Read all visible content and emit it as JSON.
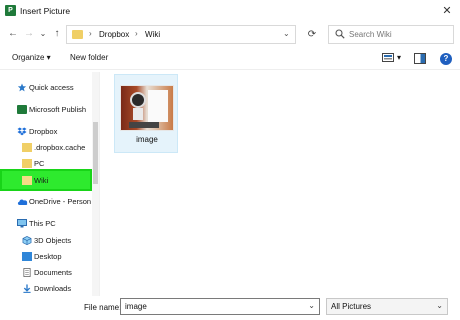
{
  "window": {
    "title": "Insert Picture",
    "close_glyph": "✕"
  },
  "address": {
    "back_glyph": "←",
    "forward_glyph": "→",
    "recent_glyph": "⌄",
    "up_glyph": "↑",
    "breadcrumb": [
      "Dropbox",
      "Wiki"
    ],
    "separator": "›",
    "dropdown_glyph": "⌄",
    "refresh_glyph": "⟳"
  },
  "search": {
    "placeholder": "Search Wiki"
  },
  "toolbar": {
    "organize_label": "Organize ▾",
    "new_folder_label": "New folder",
    "view_dropdown_glyph": "▾",
    "help_glyph": "?"
  },
  "nav": {
    "items": [
      {
        "label": "Quick access",
        "icon": "star-icon"
      },
      {
        "label": "Microsoft Publish",
        "icon": "publisher-icon"
      },
      {
        "label": "Dropbox",
        "icon": "dropbox-icon"
      },
      {
        "label": ".dropbox.cache",
        "icon": "folder-icon"
      },
      {
        "label": "PC",
        "icon": "folder-icon"
      },
      {
        "label": "Wiki",
        "icon": "folder-icon"
      },
      {
        "label": "OneDrive - Person",
        "icon": "cloud-icon"
      },
      {
        "label": "This PC",
        "icon": "computer-icon"
      },
      {
        "label": "3D Objects",
        "icon": "cube-icon"
      },
      {
        "label": "Desktop",
        "icon": "desktop-icon"
      },
      {
        "label": "Documents",
        "icon": "documents-icon"
      },
      {
        "label": "Downloads",
        "icon": "downloads-icon"
      }
    ],
    "selected": "Wiki"
  },
  "content": {
    "files": [
      {
        "name": "image",
        "icon": "image-thumbnail"
      }
    ]
  },
  "bottom": {
    "file_name_label": "File name:",
    "file_name_value": "image",
    "file_type_value": "All Pictures",
    "dropdown_glyph": "⌄"
  },
  "colors": {
    "highlight": "#2eea2e",
    "folder": "#f0cf66",
    "selection_tile": "#e5f3fb"
  }
}
